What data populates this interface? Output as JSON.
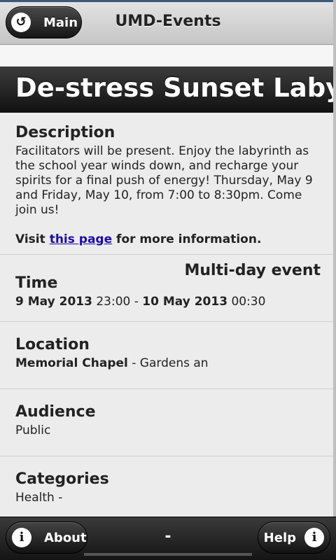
{
  "header": {
    "back_label": "Main",
    "back_icon": "back-arrow-icon",
    "back_glyph": "↺",
    "title": "UMD-Events"
  },
  "event": {
    "title": "De-stress Sunset Labyrinth",
    "description": {
      "heading": "Description",
      "text": "Facilitators will be present. Enjoy the labyrinth as the school year winds down, and recharge your spirits for a final push of energy! Thursday, May 9 and Friday, May 10, from 7:00 to 8:30pm. Come join us!",
      "visit_prefix": "Visit ",
      "link_text": "this page",
      "visit_suffix": " for more information."
    },
    "time": {
      "heading": "Time",
      "badge": "Multi-day event",
      "start_date": "9 May 2013",
      "start_time": " 23:00 - ",
      "end_date": "10 May 2013",
      "end_time": " 00:30"
    },
    "location": {
      "heading": "Location",
      "name": "Memorial Chapel",
      "detail": " - Gardens an"
    },
    "audience": {
      "heading": "Audience",
      "value": "Public"
    },
    "categories": {
      "heading": "Categories",
      "value": "Health -"
    }
  },
  "footer": {
    "about_label": "About",
    "help_label": "Help",
    "info_glyph": "i",
    "middle": "-"
  },
  "colors": {
    "link": "#1a0dab",
    "title_bar": "#1b1b1b",
    "footer": "#1f1f1f"
  }
}
